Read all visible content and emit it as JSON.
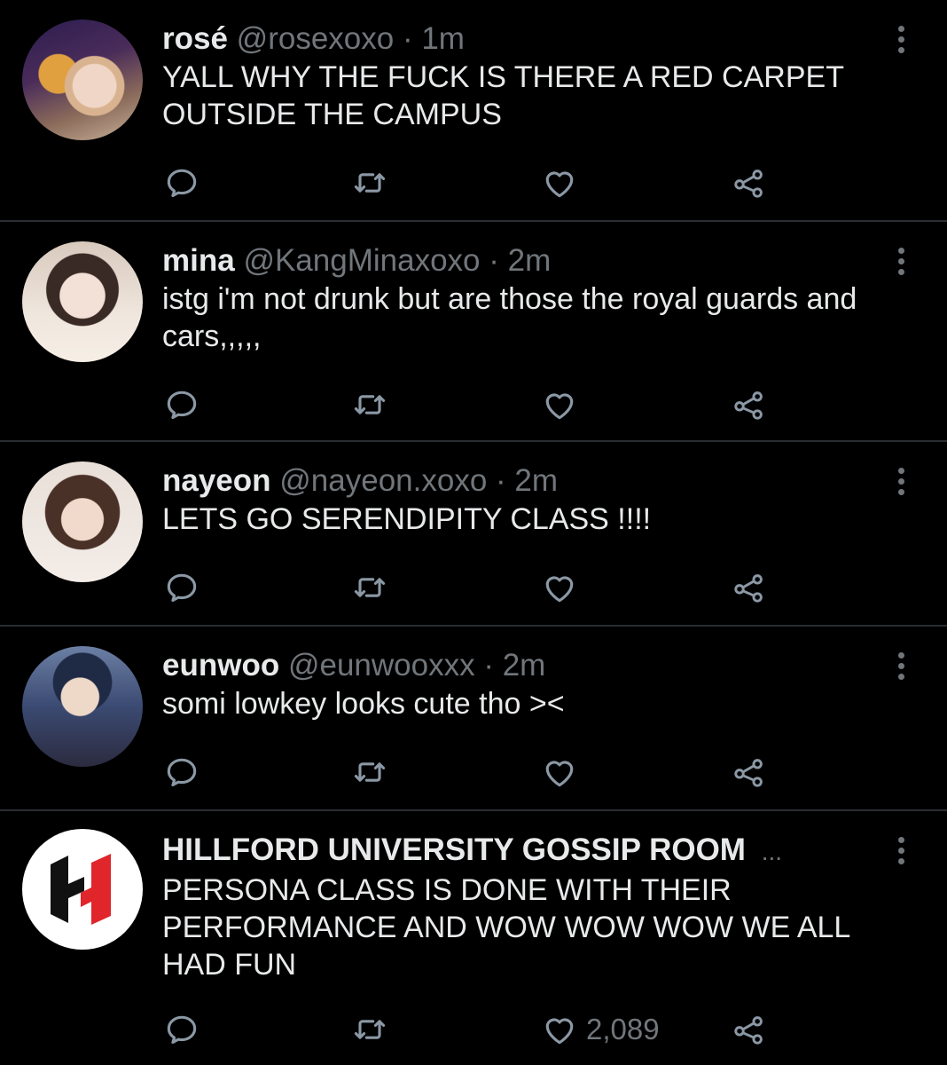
{
  "tweets": [
    {
      "name": "rosé",
      "handle": "@rosexoxo",
      "separator": "·",
      "time": "1m",
      "text": "YALL WHY THE FUCK IS THERE A RED CARPET OUTSIDE THE CAMPUS",
      "likes": ""
    },
    {
      "name": "mina",
      "handle": "@KangMinaxoxo",
      "separator": "·",
      "time": "2m",
      "text": "istg i'm not drunk but are those the royal guards and cars,,,,,",
      "likes": ""
    },
    {
      "name": "nayeon",
      "handle": "@nayeon.xoxo",
      "separator": "·",
      "time": "2m",
      "text": "LETS GO SERENDIPITY CLASS !!!!",
      "likes": ""
    },
    {
      "name": "eunwoo",
      "handle": "@eunwooxxx",
      "separator": "·",
      "time": "2m",
      "text": "somi lowkey looks cute tho ><",
      "likes": ""
    },
    {
      "name": "HILLFORD UNIVERSITY GOSSIP ROOM",
      "handle": "",
      "separator": "",
      "time": "",
      "truncation": "...",
      "text": "PERSONA CLASS IS DONE WITH THEIR PERFORMANCE AND WOW WOW WOW WE ALL HAD FUN",
      "likes": "2,089"
    }
  ],
  "colors": {
    "background": "#000000",
    "text": "#e7e9ea",
    "muted": "#71767b",
    "divider": "#2a2d31",
    "logo_red": "#e0252b"
  },
  "icons": [
    "reply-icon",
    "retweet-icon",
    "like-icon",
    "share-icon",
    "more-icon"
  ]
}
